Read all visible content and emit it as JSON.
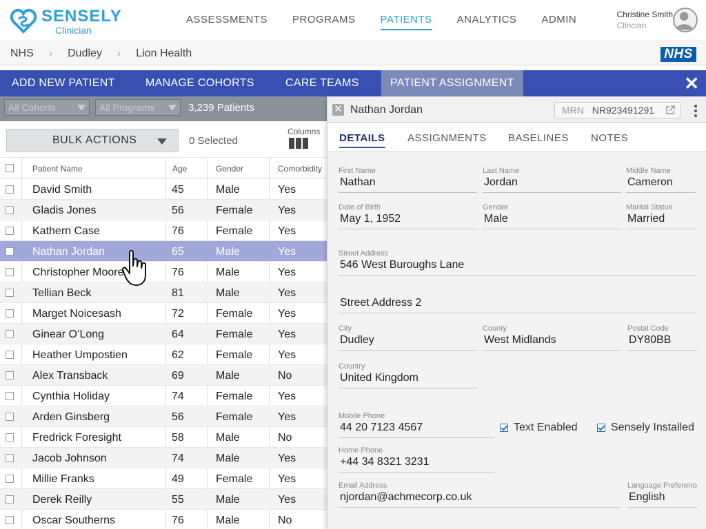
{
  "brand": {
    "name": "SENSELY",
    "sub": "Clinician"
  },
  "nav": [
    "ASSESSMENTS",
    "PROGRAMS",
    "PATIENTS",
    "ANALYTICS",
    "ADMIN"
  ],
  "user": {
    "name": "Christine Smith",
    "role": "Clincian"
  },
  "breadcrumb": [
    "NHS",
    "Dudley",
    "Lion Health"
  ],
  "nhs_logo": "NHS",
  "tabs": [
    "ADD NEW PATIENT",
    "MANAGE COHORTS",
    "CARE TEAMS",
    "PATIENT ASSIGNMENT"
  ],
  "filters": {
    "cohorts": "All Cohorts",
    "programs": "All Programs",
    "count": "3,239 Patients"
  },
  "actions": {
    "bulk": "BULK ACTIONS",
    "selected": "0 Selected",
    "columns": "Columns"
  },
  "table": {
    "headers": [
      "Patient Name",
      "Age",
      "Gender",
      "Comorbidity"
    ],
    "rows": [
      {
        "name": "David Smith",
        "age": "45",
        "gender": "Male",
        "comorbidity": "Yes"
      },
      {
        "name": "Gladis Jones",
        "age": "56",
        "gender": "Female",
        "comorbidity": "Yes"
      },
      {
        "name": "Kathern Case",
        "age": "76",
        "gender": "Female",
        "comorbidity": "Yes"
      },
      {
        "name": "Nathan Jordan",
        "age": "65",
        "gender": "Male",
        "comorbidity": "Yes"
      },
      {
        "name": "Christopher Moore",
        "age": "76",
        "gender": "Male",
        "comorbidity": "Yes"
      },
      {
        "name": "Tellian Beck",
        "age": "81",
        "gender": "Male",
        "comorbidity": "Yes"
      },
      {
        "name": "Marget Noicesash",
        "age": "72",
        "gender": "Female",
        "comorbidity": "Yes"
      },
      {
        "name": "Ginear O’Long",
        "age": "64",
        "gender": "Female",
        "comorbidity": "Yes"
      },
      {
        "name": "Heather Umpostien",
        "age": "62",
        "gender": "Female",
        "comorbidity": "Yes"
      },
      {
        "name": "Alex Transback",
        "age": "69",
        "gender": "Male",
        "comorbidity": "No"
      },
      {
        "name": "Cynthia Holiday",
        "age": "74",
        "gender": "Female",
        "comorbidity": "Yes"
      },
      {
        "name": "Arden Ginsberg",
        "age": "56",
        "gender": "Female",
        "comorbidity": "Yes"
      },
      {
        "name": "Fredrick Foresight",
        "age": "58",
        "gender": "Male",
        "comorbidity": "No"
      },
      {
        "name": "Jacob Johnson",
        "age": "74",
        "gender": "Male",
        "comorbidity": "Yes"
      },
      {
        "name": "Millie Franks",
        "age": "49",
        "gender": "Female",
        "comorbidity": "Yes"
      },
      {
        "name": "Derek Reilly",
        "age": "55",
        "gender": "Male",
        "comorbidity": "Yes"
      },
      {
        "name": "Oscar Southerns",
        "age": "76",
        "gender": "Male",
        "comorbidity": "No"
      }
    ]
  },
  "panel": {
    "name": "Nathan Jordan",
    "mrn_label": "MRN",
    "mrn": "NR923491291",
    "tabs": [
      "DETAILS",
      "ASSIGNMENTS",
      "BASELINES",
      "NOTES"
    ],
    "fields": {
      "first_name": {
        "label": "First Name",
        "value": "Nathan"
      },
      "last_name": {
        "label": "Last Name",
        "value": "Jordan"
      },
      "middle_name": {
        "label": "Middle Name",
        "value": "Cameron"
      },
      "dob": {
        "label": "Date of Birth",
        "value": "May 1, 1952"
      },
      "gender": {
        "label": "Gender",
        "value": "Male"
      },
      "marital": {
        "label": "Marital Status",
        "value": "Married"
      },
      "street1": {
        "label": "Street Address",
        "value": "546 West Buroughs Lane"
      },
      "street2": {
        "label": "",
        "value": "Street Address 2"
      },
      "city": {
        "label": "City",
        "value": "Dudley"
      },
      "county": {
        "label": "County",
        "value": "West Midlands"
      },
      "postal": {
        "label": "Postal Code",
        "value": "DY80BB"
      },
      "country": {
        "label": "Country",
        "value": "United Kingdom"
      },
      "mobile": {
        "label": "Mobile Phone",
        "value": "44 20 7123 4567"
      },
      "home": {
        "label": "Home Phone",
        "value": "+44 34 8321 3231"
      },
      "email": {
        "label": "Email Address",
        "value": "njordan@achmecorp.co.uk"
      },
      "language": {
        "label": "Language Preference",
        "value": "English"
      }
    },
    "text_enabled": "Text Enabled",
    "sensely_installed": "Sensely Installed"
  },
  "colors": {
    "accent": "#2f9fd8",
    "tabbar": "#3750b2",
    "selected_row": "#a1a8da",
    "nhs": "#0a5eb0"
  }
}
